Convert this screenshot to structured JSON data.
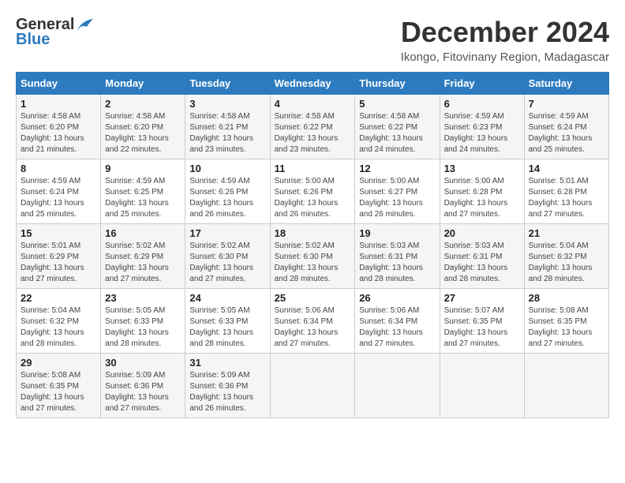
{
  "logo": {
    "general": "General",
    "blue": "Blue"
  },
  "title": "December 2024",
  "location": "Ikongo, Fitovinany Region, Madagascar",
  "days_of_week": [
    "Sunday",
    "Monday",
    "Tuesday",
    "Wednesday",
    "Thursday",
    "Friday",
    "Saturday"
  ],
  "weeks": [
    [
      {
        "day": "1",
        "sunrise": "4:58 AM",
        "sunset": "6:20 PM",
        "daylight": "13 hours and 21 minutes."
      },
      {
        "day": "2",
        "sunrise": "4:58 AM",
        "sunset": "6:20 PM",
        "daylight": "13 hours and 22 minutes."
      },
      {
        "day": "3",
        "sunrise": "4:58 AM",
        "sunset": "6:21 PM",
        "daylight": "13 hours and 23 minutes."
      },
      {
        "day": "4",
        "sunrise": "4:58 AM",
        "sunset": "6:22 PM",
        "daylight": "13 hours and 23 minutes."
      },
      {
        "day": "5",
        "sunrise": "4:58 AM",
        "sunset": "6:22 PM",
        "daylight": "13 hours and 24 minutes."
      },
      {
        "day": "6",
        "sunrise": "4:59 AM",
        "sunset": "6:23 PM",
        "daylight": "13 hours and 24 minutes."
      },
      {
        "day": "7",
        "sunrise": "4:59 AM",
        "sunset": "6:24 PM",
        "daylight": "13 hours and 25 minutes."
      }
    ],
    [
      {
        "day": "8",
        "sunrise": "4:59 AM",
        "sunset": "6:24 PM",
        "daylight": "13 hours and 25 minutes."
      },
      {
        "day": "9",
        "sunrise": "4:59 AM",
        "sunset": "6:25 PM",
        "daylight": "13 hours and 25 minutes."
      },
      {
        "day": "10",
        "sunrise": "4:59 AM",
        "sunset": "6:26 PM",
        "daylight": "13 hours and 26 minutes."
      },
      {
        "day": "11",
        "sunrise": "5:00 AM",
        "sunset": "6:26 PM",
        "daylight": "13 hours and 26 minutes."
      },
      {
        "day": "12",
        "sunrise": "5:00 AM",
        "sunset": "6:27 PM",
        "daylight": "13 hours and 26 minutes."
      },
      {
        "day": "13",
        "sunrise": "5:00 AM",
        "sunset": "6:28 PM",
        "daylight": "13 hours and 27 minutes."
      },
      {
        "day": "14",
        "sunrise": "5:01 AM",
        "sunset": "6:28 PM",
        "daylight": "13 hours and 27 minutes."
      }
    ],
    [
      {
        "day": "15",
        "sunrise": "5:01 AM",
        "sunset": "6:29 PM",
        "daylight": "13 hours and 27 minutes."
      },
      {
        "day": "16",
        "sunrise": "5:02 AM",
        "sunset": "6:29 PM",
        "daylight": "13 hours and 27 minutes."
      },
      {
        "day": "17",
        "sunrise": "5:02 AM",
        "sunset": "6:30 PM",
        "daylight": "13 hours and 27 minutes."
      },
      {
        "day": "18",
        "sunrise": "5:02 AM",
        "sunset": "6:30 PM",
        "daylight": "13 hours and 28 minutes."
      },
      {
        "day": "19",
        "sunrise": "5:03 AM",
        "sunset": "6:31 PM",
        "daylight": "13 hours and 28 minutes."
      },
      {
        "day": "20",
        "sunrise": "5:03 AM",
        "sunset": "6:31 PM",
        "daylight": "13 hours and 28 minutes."
      },
      {
        "day": "21",
        "sunrise": "5:04 AM",
        "sunset": "6:32 PM",
        "daylight": "13 hours and 28 minutes."
      }
    ],
    [
      {
        "day": "22",
        "sunrise": "5:04 AM",
        "sunset": "6:32 PM",
        "daylight": "13 hours and 28 minutes."
      },
      {
        "day": "23",
        "sunrise": "5:05 AM",
        "sunset": "6:33 PM",
        "daylight": "13 hours and 28 minutes."
      },
      {
        "day": "24",
        "sunrise": "5:05 AM",
        "sunset": "6:33 PM",
        "daylight": "13 hours and 28 minutes."
      },
      {
        "day": "25",
        "sunrise": "5:06 AM",
        "sunset": "6:34 PM",
        "daylight": "13 hours and 27 minutes."
      },
      {
        "day": "26",
        "sunrise": "5:06 AM",
        "sunset": "6:34 PM",
        "daylight": "13 hours and 27 minutes."
      },
      {
        "day": "27",
        "sunrise": "5:07 AM",
        "sunset": "6:35 PM",
        "daylight": "13 hours and 27 minutes."
      },
      {
        "day": "28",
        "sunrise": "5:08 AM",
        "sunset": "6:35 PM",
        "daylight": "13 hours and 27 minutes."
      }
    ],
    [
      {
        "day": "29",
        "sunrise": "5:08 AM",
        "sunset": "6:35 PM",
        "daylight": "13 hours and 27 minutes."
      },
      {
        "day": "30",
        "sunrise": "5:09 AM",
        "sunset": "6:36 PM",
        "daylight": "13 hours and 27 minutes."
      },
      {
        "day": "31",
        "sunrise": "5:09 AM",
        "sunset": "6:36 PM",
        "daylight": "13 hours and 26 minutes."
      },
      null,
      null,
      null,
      null
    ]
  ]
}
